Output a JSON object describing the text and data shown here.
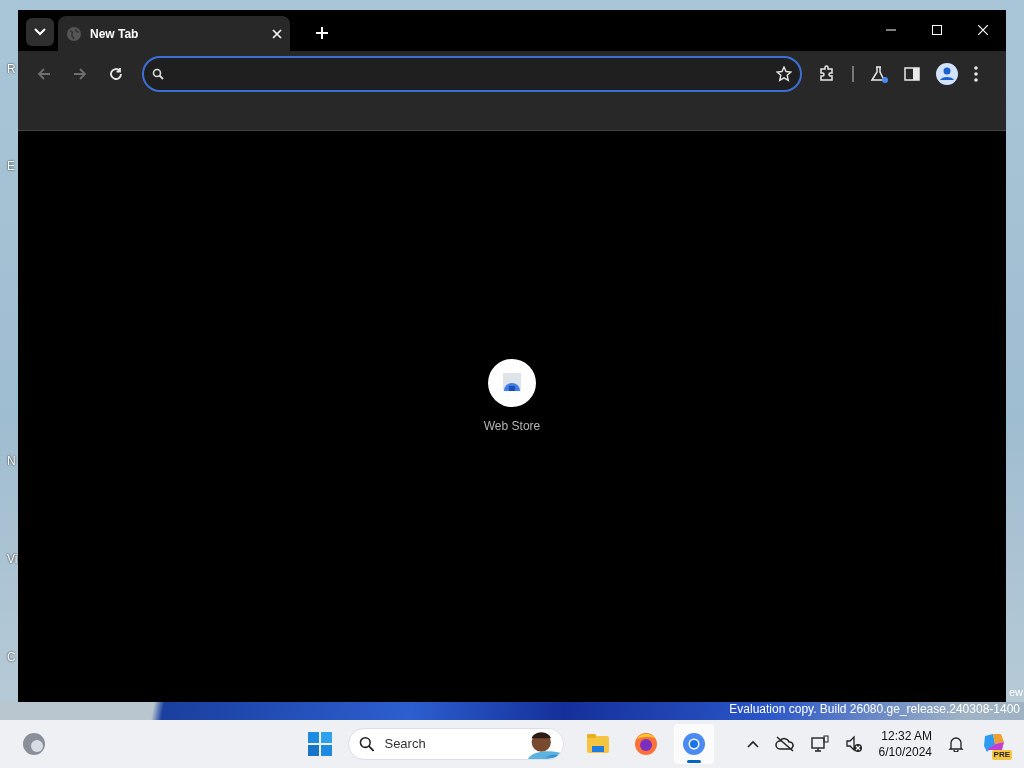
{
  "desktop": {
    "icon_labels": [
      "R",
      "E",
      "N",
      "Vi",
      "C"
    ],
    "watermark": {
      "edition": "ew",
      "build": "Evaluation copy. Build 26080.ge_release.240308-1400"
    }
  },
  "browser": {
    "tabs": [
      {
        "title": "New Tab",
        "selected": true
      }
    ],
    "toolbar": {
      "back": {
        "disabled": true
      },
      "forward": {
        "disabled": true
      },
      "omnibox": {
        "focused": true
      },
      "labs_badge": true
    },
    "shortcuts": [
      {
        "label": "Web Store"
      }
    ]
  },
  "taskbar": {
    "search": {
      "placeholder": "Search"
    },
    "apps": [
      {
        "kind": "explorer",
        "running": false
      },
      {
        "kind": "firefox",
        "running": false
      },
      {
        "kind": "chrome",
        "running": true
      }
    ],
    "clock": {
      "time": "12:32 AM",
      "date": "6/10/2024"
    },
    "copilot_badge": "PRE"
  }
}
